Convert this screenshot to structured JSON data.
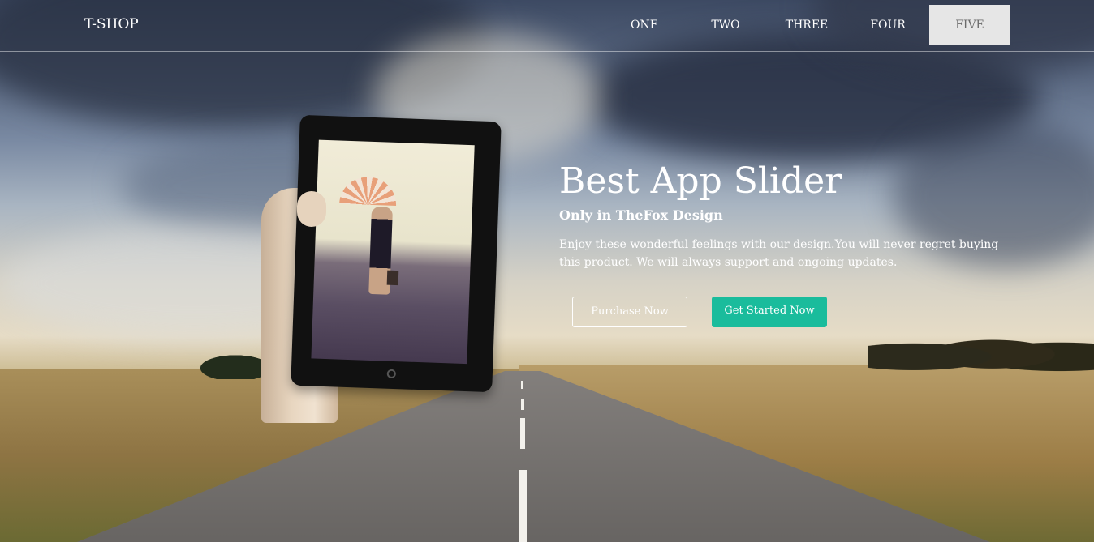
{
  "navbar": {
    "logo": "T-SHOP",
    "items": [
      {
        "label": "ONE",
        "active": false
      },
      {
        "label": "TWO",
        "active": false
      },
      {
        "label": "THREE",
        "active": false
      },
      {
        "label": "FOUR",
        "active": false
      },
      {
        "label": "FIVE",
        "active": true
      }
    ]
  },
  "slide": {
    "title": "Best App Slider",
    "subtitle": "Only in TheFox Design",
    "description": "Enjoy these wonderful feelings with our design.You will never regret buying this product. We will always support and ongoing updates.",
    "purchase_label": "Purchase Now",
    "get_started_label": "Get Started Now"
  },
  "colors": {
    "accent": "#1abc9c",
    "active_nav_bg": "#e6e6e6"
  }
}
